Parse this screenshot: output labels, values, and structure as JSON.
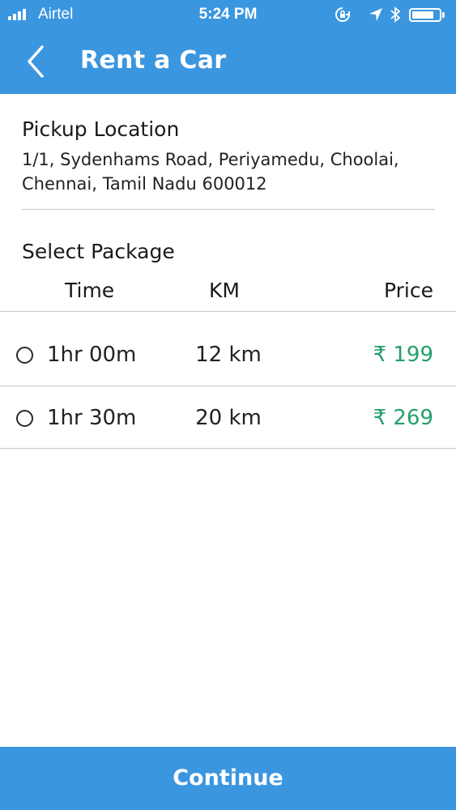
{
  "status_bar": {
    "carrier": "Airtel",
    "time": "5:24 PM",
    "icons": [
      "signal-bars-icon",
      "orientation-lock-icon",
      "location-arrow-icon",
      "bluetooth-icon",
      "battery-icon"
    ]
  },
  "nav": {
    "title": "Rent a Car",
    "back_icon": "chevron-left-icon"
  },
  "pickup": {
    "label": "Pickup Location",
    "address": "1/1, Sydenhams Road, Periyamedu, Choolai, Chennai, Tamil Nadu 600012"
  },
  "packages": {
    "title": "Select Package",
    "columns": {
      "time": "Time",
      "km": "KM",
      "price": "Price"
    },
    "rows": [
      {
        "time": "1hr 00m",
        "km": "12 km",
        "price": "₹ 199",
        "selected": false
      },
      {
        "time": "1hr 30m",
        "km": "20 km",
        "price": "₹ 269",
        "selected": false
      }
    ]
  },
  "footer": {
    "continue_label": "Continue"
  },
  "colors": {
    "primary": "#3b96e0",
    "price": "#22a06b",
    "divider": "#c8c8c8"
  }
}
